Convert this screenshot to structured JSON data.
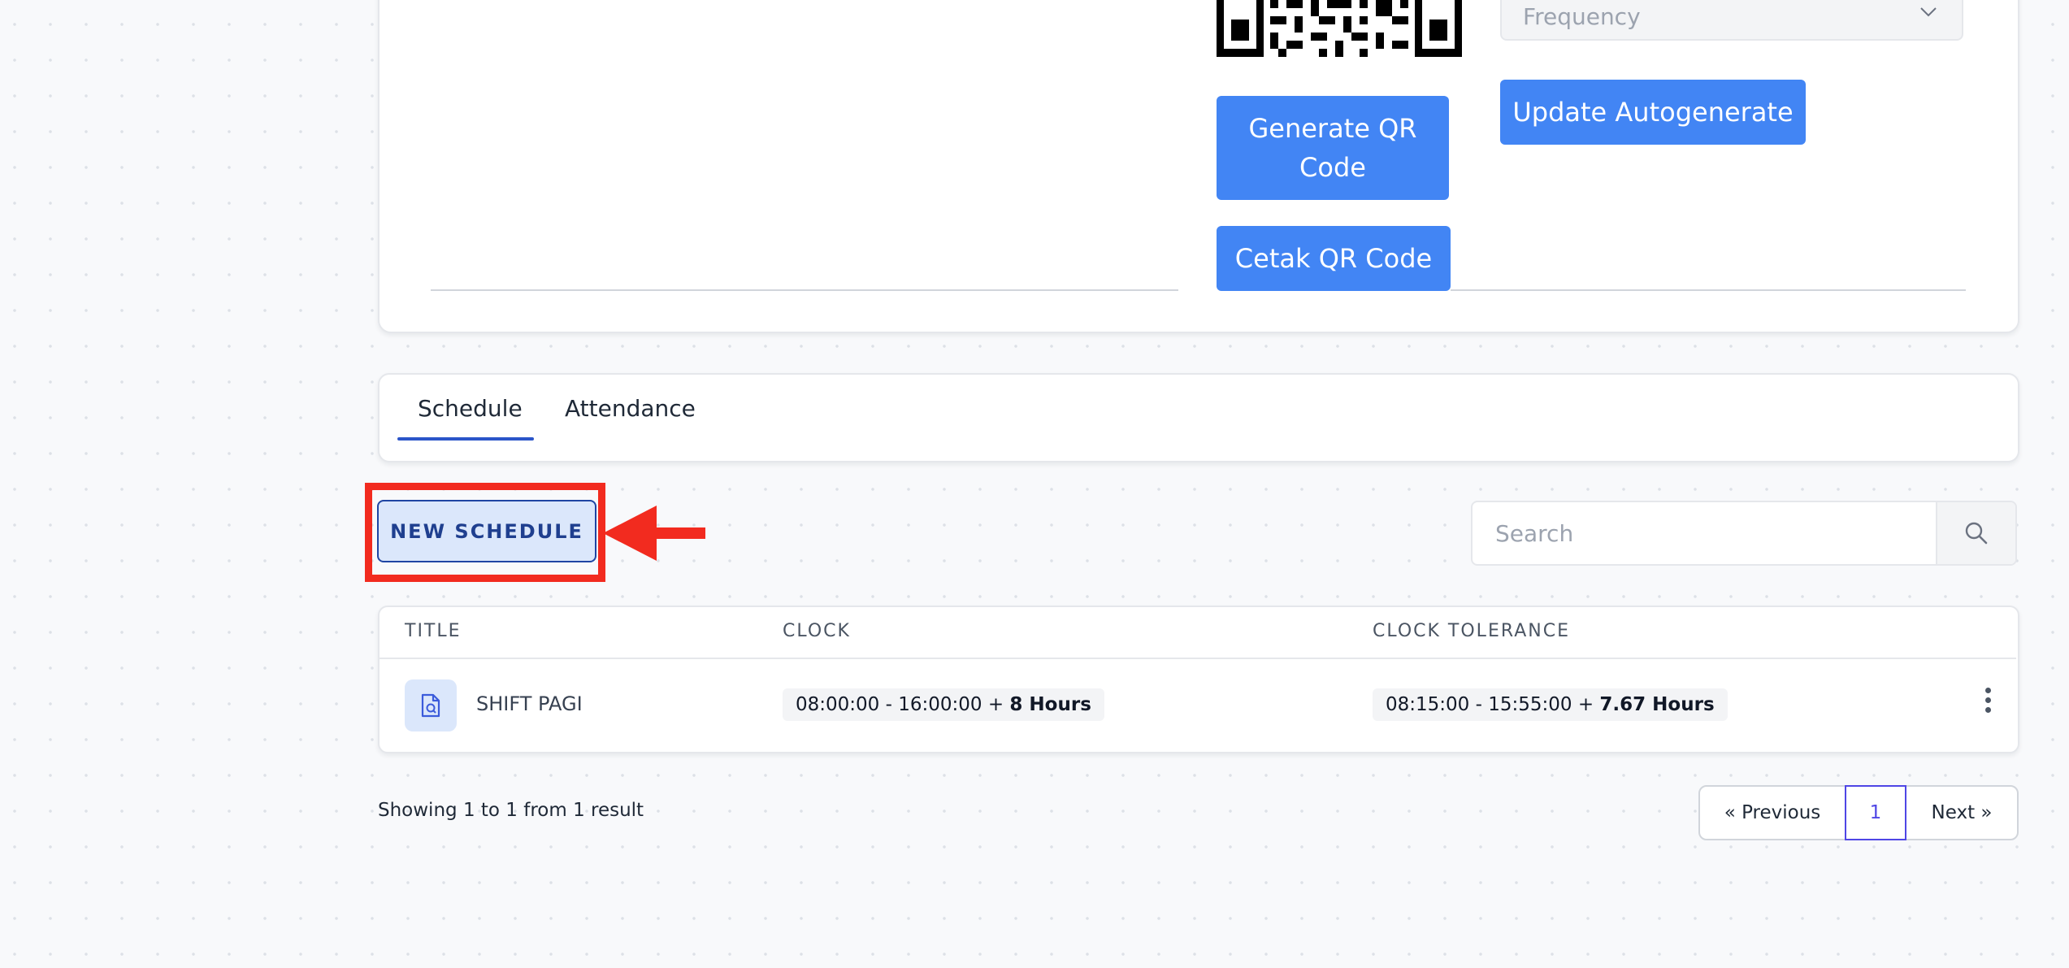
{
  "qr_section": {
    "frequency_placeholder": "Frequency",
    "generate_button": "Generate QR Code",
    "print_button": "Cetak QR Code",
    "update_button": "Update Autogenerate"
  },
  "tabs": [
    {
      "label": "Schedule",
      "active": true
    },
    {
      "label": "Attendance",
      "active": false
    }
  ],
  "toolbar": {
    "new_schedule_label": "NEW SCHEDULE",
    "search_placeholder": "Search"
  },
  "table": {
    "columns": [
      "TITLE",
      "CLOCK",
      "CLOCK TOLERANCE"
    ],
    "rows": [
      {
        "title": "SHIFT PAGI",
        "clock": "08:00:00 - 16:00:00 +",
        "clock_hours": "8 Hours",
        "tolerance": "08:15:00 - 15:55:00 +",
        "tolerance_hours": "7.67 Hours"
      }
    ]
  },
  "footer": {
    "showing_text": "Showing 1 to 1 from 1 result",
    "prev_label": "« Previous",
    "current_page": "1",
    "next_label": "Next »"
  },
  "colors": {
    "primary_button": "#4285f4",
    "annotation_red": "#f22b1f",
    "tab_underline": "#2b55c9",
    "active_page": "#4f46e5"
  }
}
